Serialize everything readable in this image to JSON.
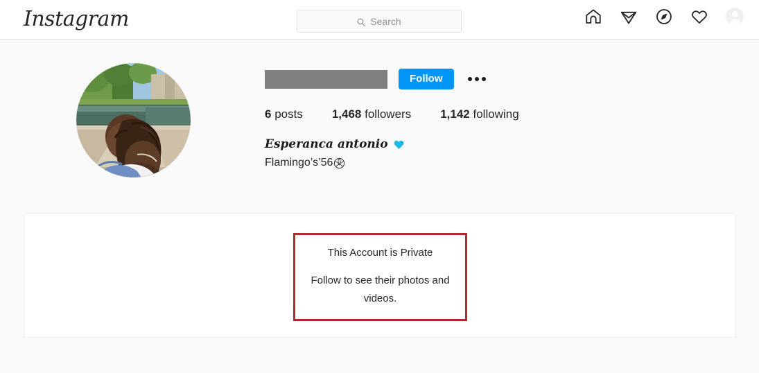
{
  "navbar": {
    "brand": "Instagram",
    "search": {
      "placeholder": "Search",
      "value": "",
      "icon": "search-icon"
    },
    "icons": [
      {
        "name": "home-icon",
        "label": "Home"
      },
      {
        "name": "direct-message-icon",
        "label": "Messages"
      },
      {
        "name": "explore-compass-icon",
        "label": "Explore"
      },
      {
        "name": "heart-activity-icon",
        "label": "Activity"
      },
      {
        "name": "profile-avatar-icon",
        "label": "Profile"
      }
    ]
  },
  "profile": {
    "avatar_alt": "profile photo",
    "username": "",
    "username_redacted": true,
    "follow_label": "Follow",
    "options_label": "More options",
    "stats": [
      {
        "value": "6",
        "label": "posts"
      },
      {
        "value": "1,468",
        "label": "followers"
      },
      {
        "value": "1,142",
        "label": "following"
      }
    ],
    "bio": {
      "display_name": "Esperanca antonio",
      "display_name_emoji": "blue-heart-emoji",
      "line2_text": "Flamingo’s’56",
      "line2_emoji": "volleyball-emoji"
    }
  },
  "private_notice": {
    "title": "This Account is Private",
    "description": "Follow to see their photos and videos."
  },
  "colors": {
    "accent_blue": "#0095f6",
    "annotation_red": "#b02a32",
    "redaction_gray": "#808080",
    "page_background": "#fafafa",
    "card_background": "#ffffff",
    "border_gray": "#dbdbdb",
    "muted_text": "#8e8e8e"
  }
}
